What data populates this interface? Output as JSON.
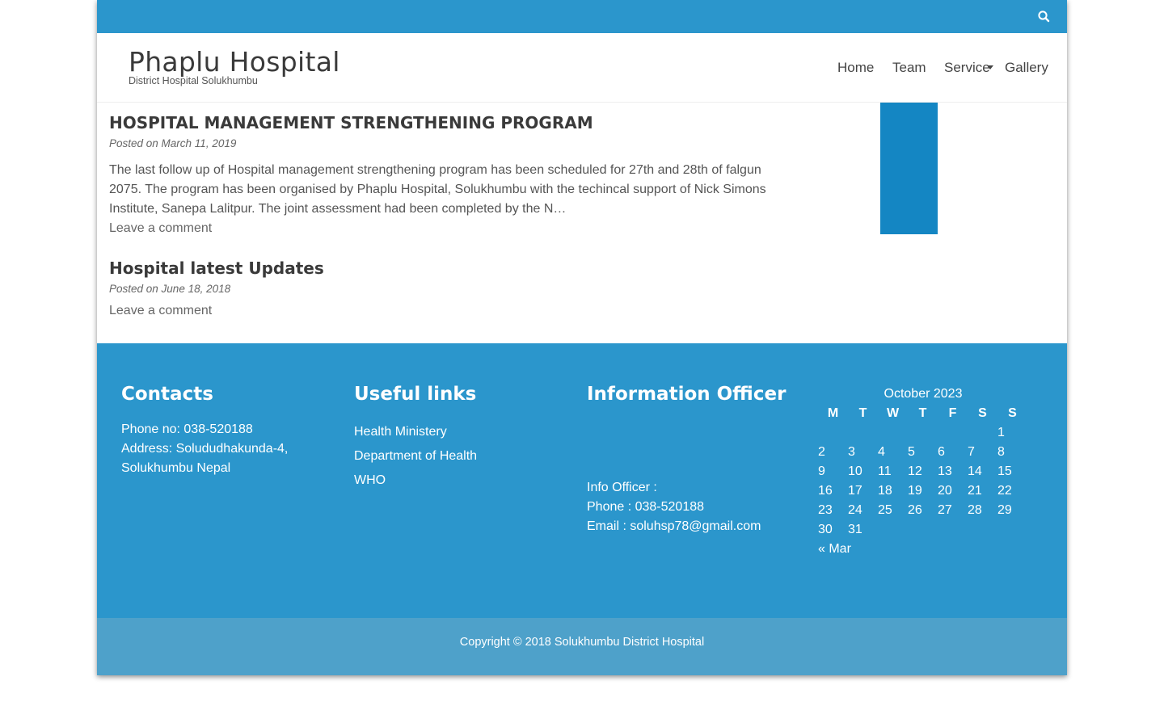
{
  "header": {
    "site_title": "Phaplu Hospital",
    "site_description": "District Hospital Solukhumbu",
    "search_icon": "search-icon"
  },
  "nav": {
    "items": [
      {
        "label": "Home"
      },
      {
        "label": "Team"
      },
      {
        "label": "Service"
      },
      {
        "label": "Gallery"
      }
    ]
  },
  "posts": [
    {
      "title": "HOSPITAL MANAGEMENT STRENGTHENING PROGRAM",
      "meta": "Posted on March 11, 2019",
      "excerpt": "The last follow up of Hospital management strengthening program has been scheduled for 27th and 28th of falgun 2075. The program has been organised by Phaplu Hospital, Solukhumbu with the techincal support of Nick Simons Institute, Sanepa Lalitpur. The joint assessment had been completed by the N…",
      "comment_link": "Leave a comment"
    },
    {
      "title": "Hospital latest Updates",
      "meta": "Posted on June 18, 2018",
      "comment_link": "Leave a comment"
    }
  ],
  "footer": {
    "contacts": {
      "heading": "Contacts",
      "phone": "Phone no: 038-520188",
      "address_line1": "Address: Solududhakunda-4,",
      "address_line2": "Solukhumbu Nepal"
    },
    "useful_links": {
      "heading": "Useful links",
      "links": [
        {
          "label": "Health Ministery"
        },
        {
          "label": "Department of Health"
        },
        {
          "label": "WHO"
        }
      ]
    },
    "info_officer": {
      "heading": "Information Officer",
      "officer": "Info Officer :",
      "phone": "Phone : 038-520188",
      "email": "Email : soluhsp78@gmail.com"
    },
    "calendar": {
      "caption": "October 2023",
      "weekdays": [
        "M",
        "T",
        "W",
        "T",
        "F",
        "S",
        "S"
      ],
      "weeks": [
        [
          "",
          "",
          "",
          "",
          "",
          "",
          "1"
        ],
        [
          "2",
          "3",
          "4",
          "5",
          "6",
          "7",
          "8"
        ],
        [
          "9",
          "10",
          "11",
          "12",
          "13",
          "14",
          "15"
        ],
        [
          "16",
          "17",
          "18",
          "19",
          "20",
          "21",
          "22"
        ],
        [
          "23",
          "24",
          "25",
          "26",
          "27",
          "28",
          "29"
        ],
        [
          "30",
          "31",
          "",
          "",
          "",
          "",
          ""
        ]
      ],
      "prev_link": "« Mar"
    },
    "copyright": "Copyright © 2018 Solukhumbu District Hospital"
  },
  "colors": {
    "primary": "#2b96cc",
    "sidebar_block": "#1486c3",
    "copyright_bar": "#4ea1ca"
  }
}
